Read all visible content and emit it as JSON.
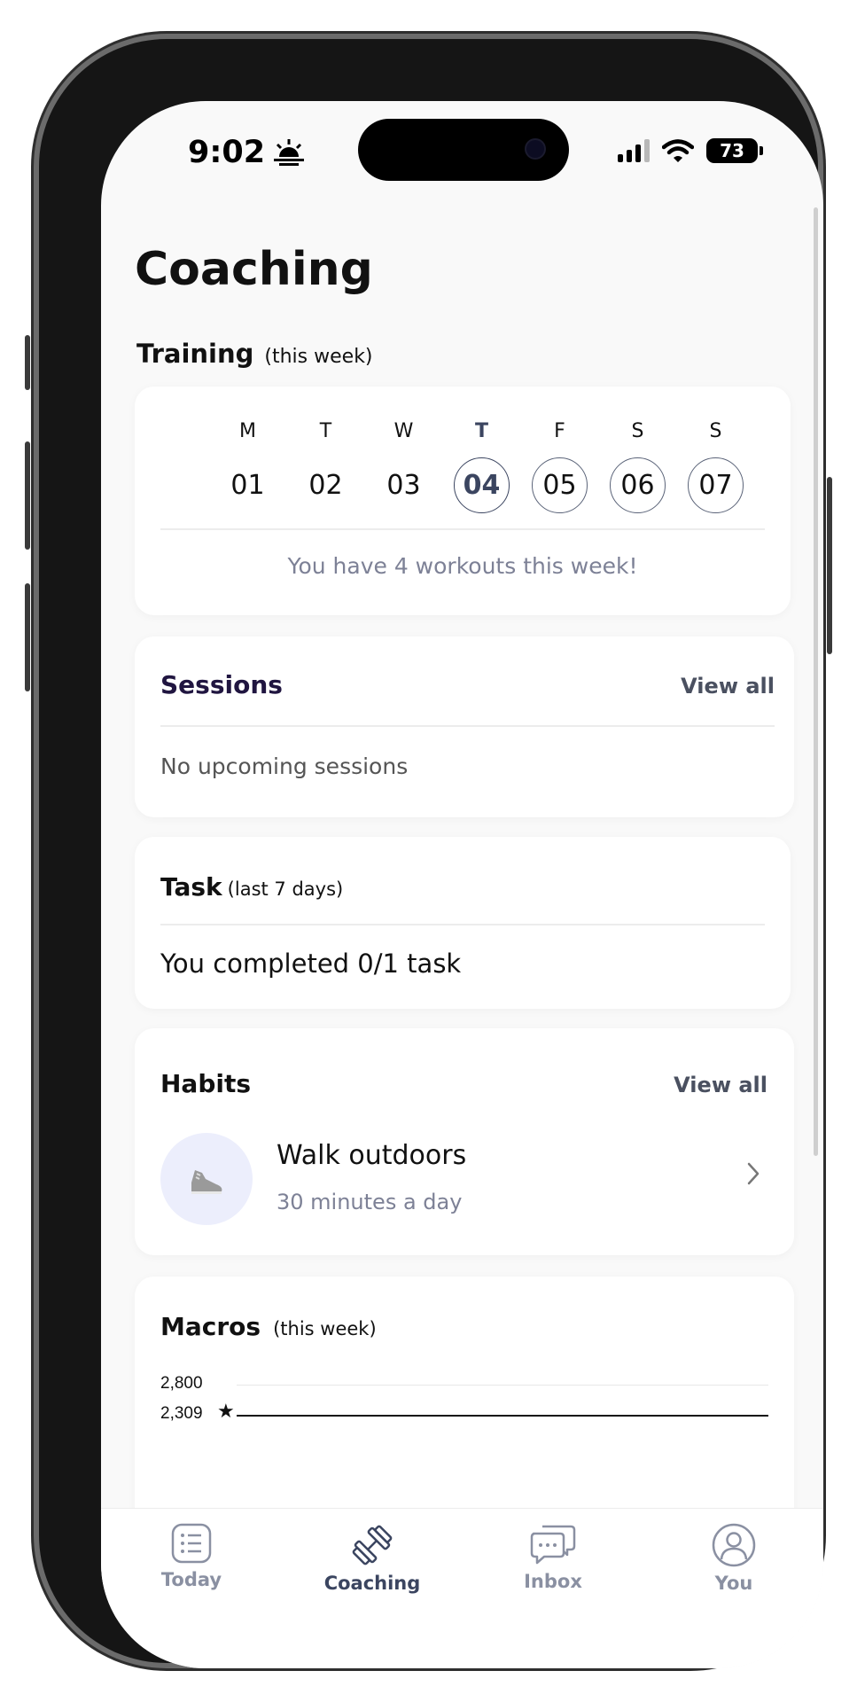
{
  "status_bar": {
    "time": "9:02",
    "battery": "73"
  },
  "page": {
    "title": "Coaching"
  },
  "training": {
    "title": "Training",
    "subtitle": "(this week)",
    "days": [
      {
        "letter": "M",
        "number": "01"
      },
      {
        "letter": "T",
        "number": "02"
      },
      {
        "letter": "W",
        "number": "03"
      },
      {
        "letter": "T",
        "number": "04"
      },
      {
        "letter": "F",
        "number": "05"
      },
      {
        "letter": "S",
        "number": "06"
      },
      {
        "letter": "S",
        "number": "07"
      }
    ],
    "message": "You have 4 workouts this week!"
  },
  "sessions": {
    "title": "Sessions",
    "view_all": "View all",
    "empty": "No upcoming sessions"
  },
  "task": {
    "title": "Task",
    "subtitle": "(last 7 days)",
    "summary": "You completed 0/1 task"
  },
  "habits": {
    "title": "Habits",
    "view_all": "View all",
    "items": [
      {
        "name": "Walk outdoors",
        "detail": "30 minutes a day"
      }
    ]
  },
  "macros": {
    "title": "Macros",
    "subtitle": "(this week)",
    "tick_top": "2,800",
    "tick_target": "2,309"
  },
  "tabs": [
    {
      "label": "Today",
      "icon": "list-icon"
    },
    {
      "label": "Coaching",
      "icon": "dumbbell-icon"
    },
    {
      "label": "Inbox",
      "icon": "chat-bubbles-icon"
    },
    {
      "label": "You",
      "icon": "person-icon"
    }
  ]
}
